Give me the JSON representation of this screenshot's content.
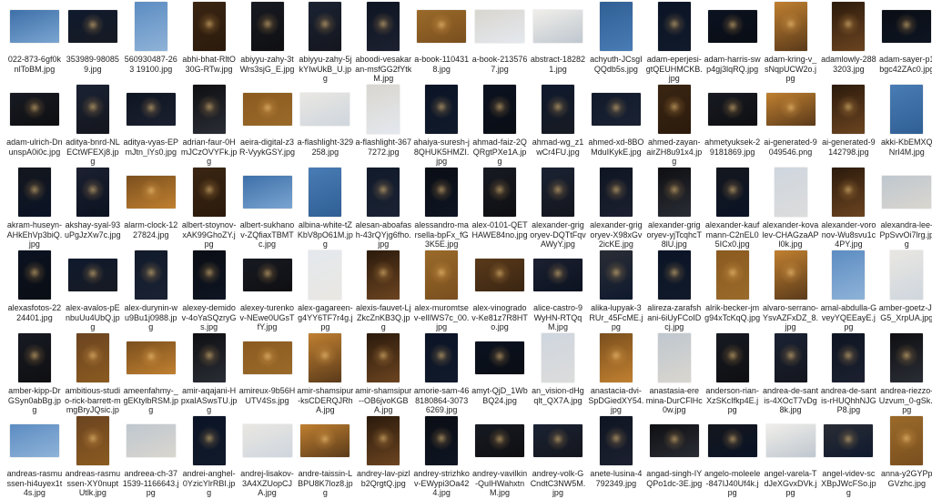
{
  "thumbnail_colors": {
    "night": [
      "#0b1220",
      "#0f1a2e",
      "#111a2a",
      "#0a0d14",
      "#171a22",
      "#1a2233",
      "#0e1522",
      "#0f0f12",
      "#14161d",
      "#1c2030",
      "#2a2d35",
      "#0a1426"
    ],
    "warm": [
      "#5a3a1a",
      "#6b4420",
      "#7a4f1e",
      "#3a2512",
      "#8a5a20",
      "#c08030",
      "#2b1a0c",
      "#9a6a2a"
    ],
    "light": [
      "#e9e7e2",
      "#d9d6cf",
      "#f0eeea",
      "#cfd6de",
      "#e4e8ee",
      "#bfc7cf",
      "#dcdcdc"
    ],
    "blue": [
      "#3d6fa8",
      "#4a7cb5",
      "#5c8cc2",
      "#7aa5d1",
      "#2f5f94",
      "#8fb3d8"
    ]
  },
  "files": [
    {
      "name": "022-873-6gf0knlToBM.jpg",
      "shape": "landscape",
      "tone": "blue"
    },
    {
      "name": "353989-980859.jpg",
      "shape": "landscape",
      "tone": "night"
    },
    {
      "name": "560930487-263 19100.jpg",
      "shape": "portrait",
      "tone": "blue"
    },
    {
      "name": "abhi-bhat-RltO30G-RTw.jpg",
      "shape": "portrait",
      "tone": "warm"
    },
    {
      "name": "abiyyu-zahy-3tWrs3sjG_E.jpg",
      "shape": "portrait",
      "tone": "night"
    },
    {
      "name": "abiyyu-zahy-5jkYIwUkB_U.jpg",
      "shape": "portrait",
      "tone": "night"
    },
    {
      "name": "aboodi-vesakaran-msfGG2fYtkM.jpg",
      "shape": "portrait",
      "tone": "night"
    },
    {
      "name": "a-book-1104318.jpg",
      "shape": "landscape",
      "tone": "warm"
    },
    {
      "name": "a-book-2135767.jpg",
      "shape": "landscape",
      "tone": "light"
    },
    {
      "name": "abstract-182821.jpg",
      "shape": "landscape",
      "tone": "light"
    },
    {
      "name": "achyuth-JCsgIQQdb5s.jpg",
      "shape": "portrait",
      "tone": "blue"
    },
    {
      "name": "adam-eperjesi-gtQEUHMCKB.jpg",
      "shape": "portrait",
      "tone": "night"
    },
    {
      "name": "adam-harris-sw p4gj3lqRQ.jpg",
      "shape": "landscape",
      "tone": "night"
    },
    {
      "name": "adam-kring-v_sNqpUCW2o.jpg",
      "shape": "portrait",
      "tone": "warm"
    },
    {
      "name": "adamlowly-2883203.jpg",
      "shape": "portrait",
      "tone": "warm"
    },
    {
      "name": "adam-sayer-p1bgc42ZAc0.jpg",
      "shape": "landscape",
      "tone": "night"
    },
    {
      "name": "adam-ulrich-DnunspA0i0c.jpg",
      "shape": "landscape",
      "tone": "night"
    },
    {
      "name": "aditya-bnrd-NLECtWFEXj8.jpg",
      "shape": "portrait",
      "tone": "night"
    },
    {
      "name": "aditya-vyas-EPmJtn_lYs0.jpg",
      "shape": "landscape",
      "tone": "night"
    },
    {
      "name": "adrian-faur-0HmJCzOVYFk.jpg",
      "shape": "portrait",
      "tone": "night"
    },
    {
      "name": "aeira-digital-z3R-VyykGSY.jpg",
      "shape": "landscape",
      "tone": "warm"
    },
    {
      "name": "a-flashlight-329258.jpg",
      "shape": "landscape",
      "tone": "light"
    },
    {
      "name": "a-flashlight-3677272.jpg",
      "shape": "portrait",
      "tone": "light"
    },
    {
      "name": "ahaiya-suresh-j8QHUK5HMZI.jpg",
      "shape": "portrait",
      "tone": "night"
    },
    {
      "name": "ahmad-faiz-2QQRgtPXe1A.jpg",
      "shape": "portrait",
      "tone": "night"
    },
    {
      "name": "ahmad-wg_z1wCr4FU.jpg",
      "shape": "portrait",
      "tone": "night"
    },
    {
      "name": "ahmed-xd-8BOMduIKykE.jpg",
      "shape": "landscape",
      "tone": "night"
    },
    {
      "name": "ahmed-zayan-airZH8u91x4.jpg",
      "shape": "portrait",
      "tone": "warm"
    },
    {
      "name": "ahmetyuksek-29181869.jpg",
      "shape": "landscape",
      "tone": "night"
    },
    {
      "name": "ai-generated-9049546.png",
      "shape": "landscape",
      "tone": "warm"
    },
    {
      "name": "ai-generated-9142798.jpg",
      "shape": "portrait",
      "tone": "warm"
    },
    {
      "name": "akki-KbEMXQNrI4M.jpg",
      "shape": "portrait",
      "tone": "blue"
    },
    {
      "name": "akram-huseyn-AHkEhVp3biQ.jpg",
      "shape": "portrait",
      "tone": "night"
    },
    {
      "name": "akshay-syal-93uPgJzXw7c.jpg",
      "shape": "portrait",
      "tone": "night"
    },
    {
      "name": "alarm-clock-1227824.jpg",
      "shape": "landscape",
      "tone": "warm"
    },
    {
      "name": "albert-stoynov-xAK99GhoZY.jpg",
      "shape": "portrait",
      "tone": "warm"
    },
    {
      "name": "albert-sukhanov-ZQfiaxTBMTc.jpg",
      "shape": "landscape",
      "tone": "blue"
    },
    {
      "name": "albina-white-tZKbV8pO61M.jpg",
      "shape": "portrait",
      "tone": "blue"
    },
    {
      "name": "alesan-aboafash-43rQYjg6fho.jpg",
      "shape": "portrait",
      "tone": "night"
    },
    {
      "name": "alessandro-marsella-bpFx_fG3K5E.jpg",
      "shape": "portrait",
      "tone": "night"
    },
    {
      "name": "alex-0101-QETHAWE84no.jpg",
      "shape": "portrait",
      "tone": "night"
    },
    {
      "name": "alexander-grigoryev-DQTtFqvAWyY.jpg",
      "shape": "portrait",
      "tone": "night"
    },
    {
      "name": "alexander-grigoryev-X98xGv2icKE.jpg",
      "shape": "portrait",
      "tone": "night"
    },
    {
      "name": "alexander-grigoryev-yjTcqhcT8lU.jpg",
      "shape": "portrait",
      "tone": "night"
    },
    {
      "name": "alexander-kaufmann-C2nEL05ICx0.jpg",
      "shape": "portrait",
      "tone": "night"
    },
    {
      "name": "alexander-kovalev-CHAGzaAPl0k.jpg",
      "shape": "portrait",
      "tone": "light"
    },
    {
      "name": "alexander-voronov-Wu8svu1c4PY.jpg",
      "shape": "portrait",
      "tone": "warm"
    },
    {
      "name": "alexandra-lee-PpSvvOi7lrg.jpg",
      "shape": "landscape",
      "tone": "light"
    },
    {
      "name": "alexasfotos-2224401.jpg",
      "shape": "portrait",
      "tone": "night"
    },
    {
      "name": "alex-avalos-pEnbuUu4UbQ.jpg",
      "shape": "landscape",
      "tone": "night"
    },
    {
      "name": "alex-durynin-wu9Bu1j0988.jpg",
      "shape": "portrait",
      "tone": "night"
    },
    {
      "name": "alexey-demidov-4oYaSQzryGs.jpg",
      "shape": "portrait",
      "tone": "night"
    },
    {
      "name": "alexey-turenkov-NEwe0UGsTfY.jpg",
      "shape": "landscape",
      "tone": "night"
    },
    {
      "name": "alex-gagareen-g4YY6TF7r4g.jpg",
      "shape": "portrait",
      "tone": "light"
    },
    {
      "name": "alexis-fauvet-LjZkcZnKB3Q.jpg",
      "shape": "portrait",
      "tone": "warm"
    },
    {
      "name": "alex-muromtsev-elIlWS7c_00.jpg",
      "shape": "portrait",
      "tone": "warm"
    },
    {
      "name": "alex-vinogradov-Ke81z7R8HTo.jpg",
      "shape": "landscape",
      "tone": "warm"
    },
    {
      "name": "alice-castro-9WyHN-RTQqM.jpg",
      "shape": "landscape",
      "tone": "night"
    },
    {
      "name": "alika-lupyak-3RUr_45FcME.jpg",
      "shape": "portrait",
      "tone": "night"
    },
    {
      "name": "alireza-zarafshani-6iUyFCoIDcj.jpg",
      "shape": "portrait",
      "tone": "night"
    },
    {
      "name": "alrik-becker-jmg94xTcKqQ.jpg",
      "shape": "portrait",
      "tone": "warm"
    },
    {
      "name": "alvaro-serrano-YsvAZFxDZ_8.jpg",
      "shape": "portrait",
      "tone": "warm"
    },
    {
      "name": "amal-abdulla-GveyYQEEayE.jpg",
      "shape": "portrait",
      "tone": "blue"
    },
    {
      "name": "amber-goetz-JrG5_XrpUA.jpg",
      "shape": "portrait",
      "tone": "light"
    },
    {
      "name": "amber-kipp-DrGSyn0abBg.jpg",
      "shape": "portrait",
      "tone": "night"
    },
    {
      "name": "ambitious-studio-rick-barrett-mmgBryJQsic.jpg",
      "shape": "portrait",
      "tone": "warm"
    },
    {
      "name": "ameenfahmy-_gEKtylbRSM.jpg",
      "shape": "landscape",
      "tone": "warm"
    },
    {
      "name": "amir-aqajani-HpxaIASwsTU.jpg",
      "shape": "portrait",
      "tone": "night"
    },
    {
      "name": "amireux-9b56HUTV4Ss.jpg",
      "shape": "landscape",
      "tone": "warm"
    },
    {
      "name": "amir-shamsipur-ksCDERQJRhA.jpg",
      "shape": "portrait",
      "tone": "warm"
    },
    {
      "name": "amir-shamsipur--OB6jvoKGBA.jpg",
      "shape": "portrait",
      "tone": "warm"
    },
    {
      "name": "amorie-sam-468180864-30736269.jpg",
      "shape": "portrait",
      "tone": "night"
    },
    {
      "name": "amyt-QjD_1WbBQ24.jpg",
      "shape": "landscape",
      "tone": "night"
    },
    {
      "name": "an_vision-dHgqlt_QX7A.jpg",
      "shape": "portrait",
      "tone": "light"
    },
    {
      "name": "anastacia-dvi-SpDGiedXY54.jpg",
      "shape": "portrait",
      "tone": "warm"
    },
    {
      "name": "anastasia-eremina-DurCFlHc0w.jpg",
      "shape": "portrait",
      "tone": "light"
    },
    {
      "name": "anderson-rian-XzSKcIfkp4E.jpg",
      "shape": "portrait",
      "tone": "night"
    },
    {
      "name": "andrea-de-santis-4XOcT7vDg8k.jpg",
      "shape": "portrait",
      "tone": "night"
    },
    {
      "name": "andrea-de-santis-rHUQhhNJGP8.jpg",
      "shape": "portrait",
      "tone": "night"
    },
    {
      "name": "andrea-riezzo-Uzvum_0-gSk.jpg",
      "shape": "portrait",
      "tone": "night"
    },
    {
      "name": "andreas-rasmussen-hi4uyex1t4s.jpg",
      "shape": "landscape",
      "tone": "blue"
    },
    {
      "name": "andreas-rasmussen-XY0nuptUtlk.jpg",
      "shape": "portrait",
      "tone": "warm"
    },
    {
      "name": "andreea-ch-371539-1166643.jpg",
      "shape": "landscape",
      "tone": "light"
    },
    {
      "name": "andrei-anghel-0YzicYlrRBI.jpg",
      "shape": "portrait",
      "tone": "night"
    },
    {
      "name": "andrej-lisakov-3A4XZUopCJA.jpg",
      "shape": "landscape",
      "tone": "light"
    },
    {
      "name": "andre-taissin-LBPU8K7loz8.jpg",
      "shape": "landscape",
      "tone": "warm"
    },
    {
      "name": "andrey-lav-pizlb2QrgtQ.jpg",
      "shape": "portrait",
      "tone": "warm"
    },
    {
      "name": "andrey-strizhkov-EWypi3Oa424.jpg",
      "shape": "portrait",
      "tone": "night"
    },
    {
      "name": "andrey-vavilkin-QuIHWahxtnM.jpg",
      "shape": "landscape",
      "tone": "night"
    },
    {
      "name": "andrey-volk-GCndtC3NW5M.jpg",
      "shape": "landscape",
      "tone": "night"
    },
    {
      "name": "anete-lusina-4792349.jpg",
      "shape": "portrait",
      "tone": "night"
    },
    {
      "name": "angad-singh-IYQPo1dc-3E.jpg",
      "shape": "landscape",
      "tone": "night"
    },
    {
      "name": "angelo-moleele-847IJ40Uf4k.jpg",
      "shape": "landscape",
      "tone": "night"
    },
    {
      "name": "angel-varela-TdJeXGvxDVk.jpg",
      "shape": "landscape",
      "tone": "light"
    },
    {
      "name": "angel-videv-scXBpJWcFSo.jpg",
      "shape": "landscape",
      "tone": "night"
    },
    {
      "name": "anna-y2GYPpGVzhc.jpg",
      "shape": "portrait",
      "tone": "warm"
    }
  ]
}
